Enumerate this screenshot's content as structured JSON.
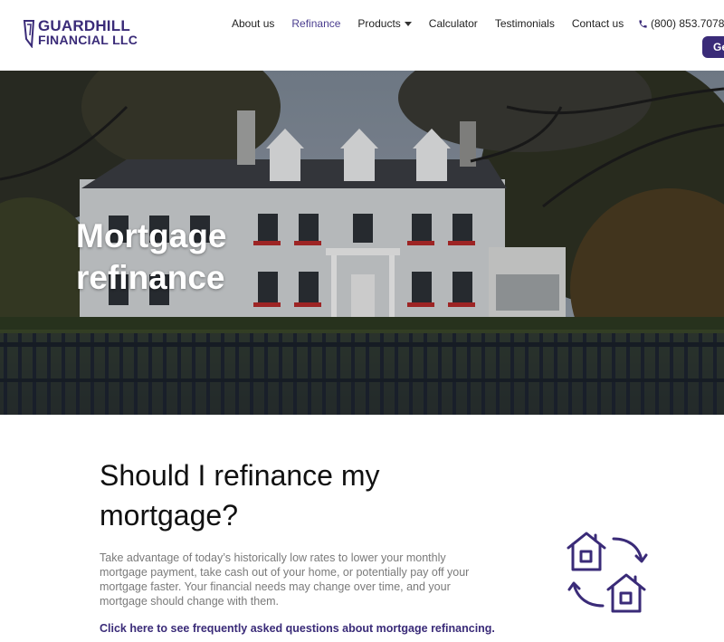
{
  "header": {
    "logo_line1": "GUARDHILL",
    "logo_line2": "FINANCIAL LLC",
    "nav": [
      {
        "label": "About us"
      },
      {
        "label": "Refinance"
      },
      {
        "label": "Products"
      },
      {
        "label": "Calculator"
      },
      {
        "label": "Testimonials"
      },
      {
        "label": "Contact us"
      }
    ],
    "phone": "(800) 853.7078",
    "cta_label": "Ge"
  },
  "hero": {
    "title_line1": "Mortgage",
    "title_line2": "refinance"
  },
  "content": {
    "heading": "Should I refinance my mortgage?",
    "paragraph": "Take advantage of today’s historically low rates to lower your monthly mortgage payment, take cash out of your home, or potentially pay off your mortgage faster.  Your financial needs may change over time, and your mortgage should change with them.",
    "faq_link": "Click here to see frequently asked questions about mortgage refinancing."
  },
  "colors": {
    "brand": "#3a2b78",
    "active_nav": "#4a3d8f"
  },
  "icons": [
    "logo-mark-icon",
    "phone-icon",
    "chevron-down-icon",
    "house-refinance-icon"
  ]
}
